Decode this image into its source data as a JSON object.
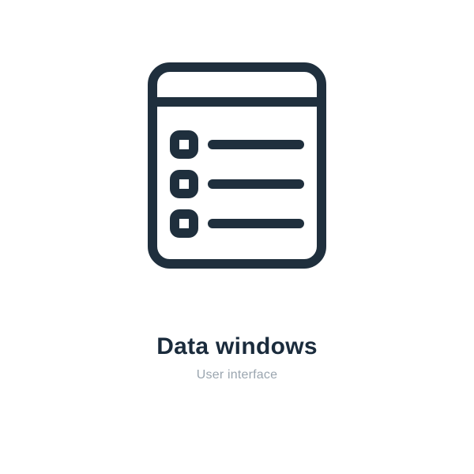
{
  "icon": {
    "name": "data-windows",
    "stroke_color": "#1f2f3d"
  },
  "title": "Data windows",
  "subtitle": "User interface"
}
